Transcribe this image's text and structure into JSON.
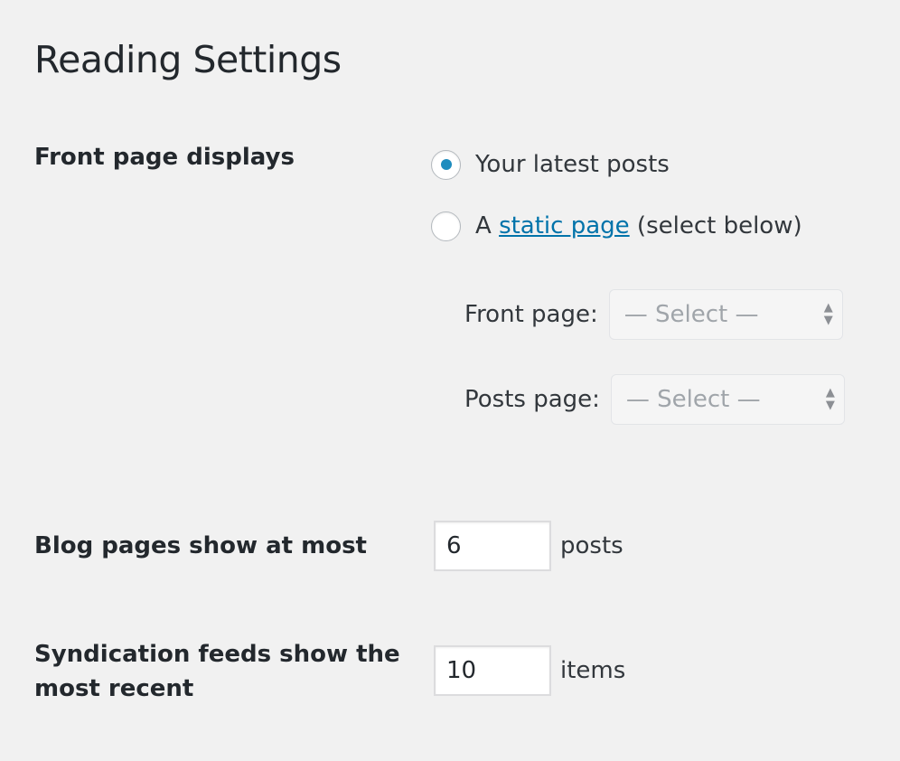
{
  "page": {
    "title": "Reading Settings"
  },
  "front_page_displays": {
    "label": "Front page displays",
    "options": {
      "latest_posts": {
        "label": "Your latest posts",
        "checked": true
      },
      "static_page": {
        "prefix": "A",
        "link_text": "static page",
        "suffix": "(select below)",
        "checked": false
      }
    },
    "front_page": {
      "label": "Front page:",
      "value": "— Select —"
    },
    "posts_page": {
      "label": "Posts page:",
      "value": "— Select —"
    }
  },
  "blog_pages": {
    "label": "Blog pages show at most",
    "value": "6",
    "unit": "posts"
  },
  "syndication": {
    "label": "Syndication feeds show the most recent",
    "value": "10",
    "unit": "items"
  },
  "colors": {
    "background": "#f1f1f1",
    "accent": "#1e8cbe",
    "link": "#0073aa",
    "text": "#23282d"
  }
}
